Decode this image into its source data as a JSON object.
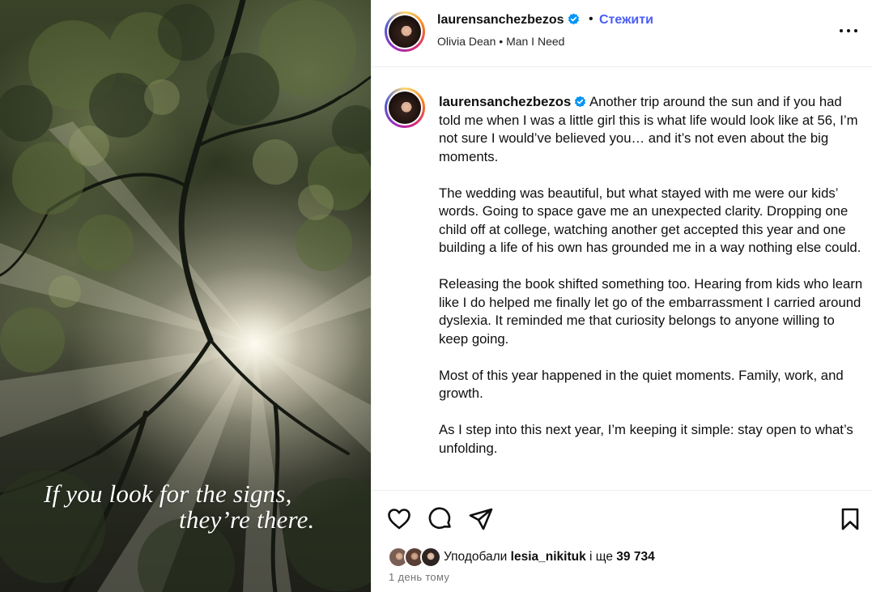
{
  "post": {
    "username": "laurensanchezbezos",
    "follow_label": "Стежити",
    "separator": "•",
    "music_artist": "Olivia Dean",
    "music_separator": " • ",
    "music_title": "Man I Need"
  },
  "media": {
    "quote_line1": "If you look for the signs,",
    "quote_line2": "they’re there."
  },
  "caption": {
    "username": "laurensanchezbezos",
    "paragraphs": [
      "Another trip around the sun and if you had told me when I was a little girl this is what life would look like at 56, I’m not sure I would’ve believed you… and it’s not even about the big moments.",
      "The wedding was beautiful, but what stayed with me were our kids’ words. Going to space gave me an unexpected clarity. Dropping one child off at college, watching another get accepted this year and one building a life of his own has grounded me in a way nothing else could.",
      "Releasing the book shifted something too. Hearing from kids who learn like I do helped me finally let go of the embarrassment I carried around dyslexia. It reminded me that curiosity belongs to anyone willing to keep going.",
      "Most of this year happened in the quiet moments. Family, work, and growth.",
      "As I step into this next year, I’m keeping it simple: stay open to what’s unfolding."
    ]
  },
  "likes": {
    "prefix": "Уподобали",
    "liker": "lesia_nikituk",
    "middle": "і ще",
    "count": "39 734"
  },
  "timestamp": "1 день тому",
  "icons": {
    "verified": "verified-badge-icon",
    "more": "more-options-icon",
    "like": "heart-icon",
    "comment": "comment-icon",
    "share": "share-icon",
    "save": "bookmark-icon"
  },
  "colors": {
    "follow": "#4a5df9",
    "verified": "#0095f6",
    "muted": "#737373"
  }
}
